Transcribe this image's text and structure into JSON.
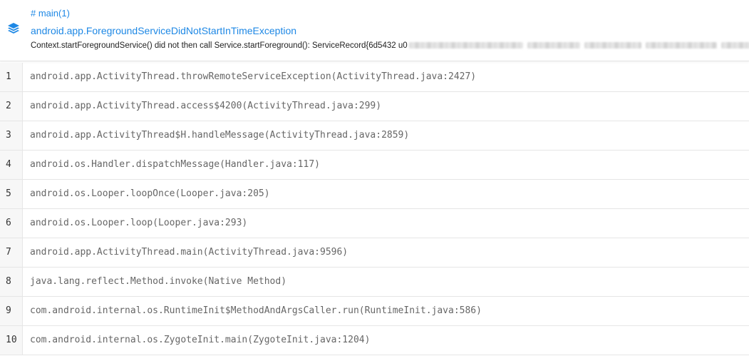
{
  "header": {
    "thread": "# main(1)",
    "exception": "android.app.ForegroundServiceDidNotStartInTimeException",
    "message": "Context.startForegroundService() did not then call Service.startForeground(): ServiceRecord{6d5432 u0",
    "icon": "layers-icon",
    "accent_color": "#1e88e5"
  },
  "frames": [
    {
      "num": "1",
      "text": "android.app.ActivityThread.throwRemoteServiceException(ActivityThread.java:2427)"
    },
    {
      "num": "2",
      "text": "android.app.ActivityThread.access$4200(ActivityThread.java:299)"
    },
    {
      "num": "3",
      "text": "android.app.ActivityThread$H.handleMessage(ActivityThread.java:2859)"
    },
    {
      "num": "4",
      "text": "android.os.Handler.dispatchMessage(Handler.java:117)"
    },
    {
      "num": "5",
      "text": "android.os.Looper.loopOnce(Looper.java:205)"
    },
    {
      "num": "6",
      "text": "android.os.Looper.loop(Looper.java:293)"
    },
    {
      "num": "7",
      "text": "android.app.ActivityThread.main(ActivityThread.java:9596)"
    },
    {
      "num": "8",
      "text": "java.lang.reflect.Method.invoke(Native Method)"
    },
    {
      "num": "9",
      "text": "com.android.internal.os.RuntimeInit$MethodAndArgsCaller.run(RuntimeInit.java:586)"
    },
    {
      "num": "10",
      "text": "com.android.internal.os.ZygoteInit.main(ZygoteInit.java:1204)"
    }
  ]
}
